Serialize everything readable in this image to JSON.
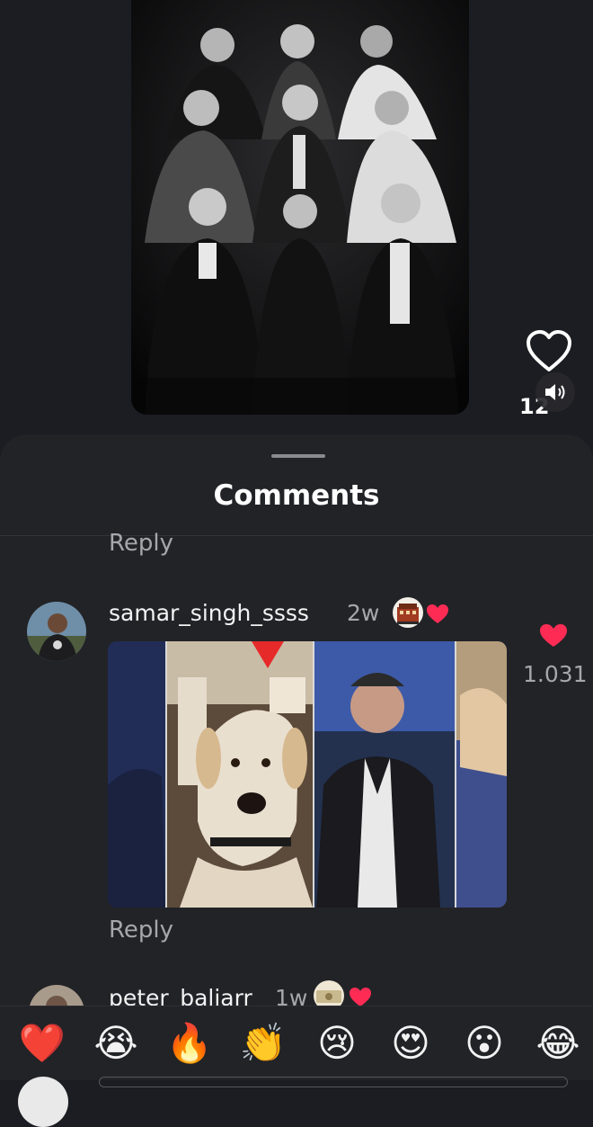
{
  "post": {
    "like_count": "12",
    "like_icon": "heart-outline-icon",
    "sound_icon": "speaker-icon"
  },
  "sheet": {
    "title": "Comments",
    "reply_label": "Reply"
  },
  "comments": [
    {
      "username": "samar_singh_ssss",
      "time": "2w",
      "like_count": "1.031",
      "reply_label": "Reply"
    },
    {
      "username": "peter_baliarr",
      "time": "1w"
    }
  ],
  "emoji_bar": [
    "❤️",
    "😭",
    "🔥",
    "👏",
    "😢",
    "😍",
    "😮",
    "😂"
  ],
  "colors": {
    "sheet_bg": "#222327",
    "accent_red": "#fe2c55",
    "muted_text": "#a6a7ac"
  }
}
